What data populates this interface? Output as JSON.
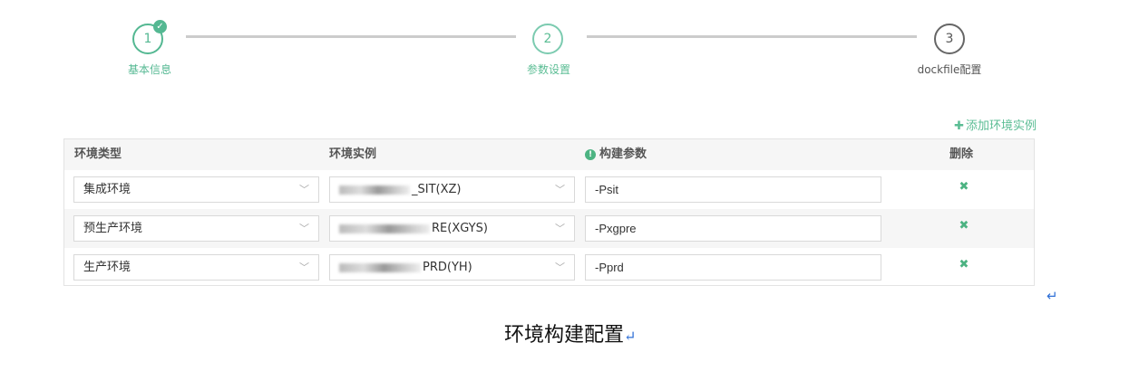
{
  "stepper": {
    "steps": [
      {
        "number": "1",
        "label": "基本信息",
        "status": "done"
      },
      {
        "number": "2",
        "label": "参数设置",
        "status": "active"
      },
      {
        "number": "3",
        "label": "dockfile配置",
        "status": "pending"
      }
    ],
    "colors": {
      "done": "#54b892",
      "active": "#5bbd94",
      "pending": "#555555"
    }
  },
  "add_instance_label": "添加环境实例",
  "table": {
    "headers": {
      "env_type": "环境类型",
      "env_instance": "环境实例",
      "build_params": "构建参数",
      "delete": "删除"
    },
    "rows": [
      {
        "env_type": "集成环境",
        "env_instance": "_SIT(XZ)",
        "build_params": "-Psit"
      },
      {
        "env_type": "预生产环境",
        "env_instance": "RE(XGYS)",
        "build_params": "-Pxgpre"
      },
      {
        "env_type": "生产环境",
        "env_instance": "PRD(YH)",
        "build_params": "-Pprd"
      }
    ]
  },
  "caption": "环境构建配置",
  "icons": {
    "dropdown": "chevron-down-icon",
    "delete": "close-icon",
    "info": "info-icon",
    "add": "plus-icon"
  }
}
